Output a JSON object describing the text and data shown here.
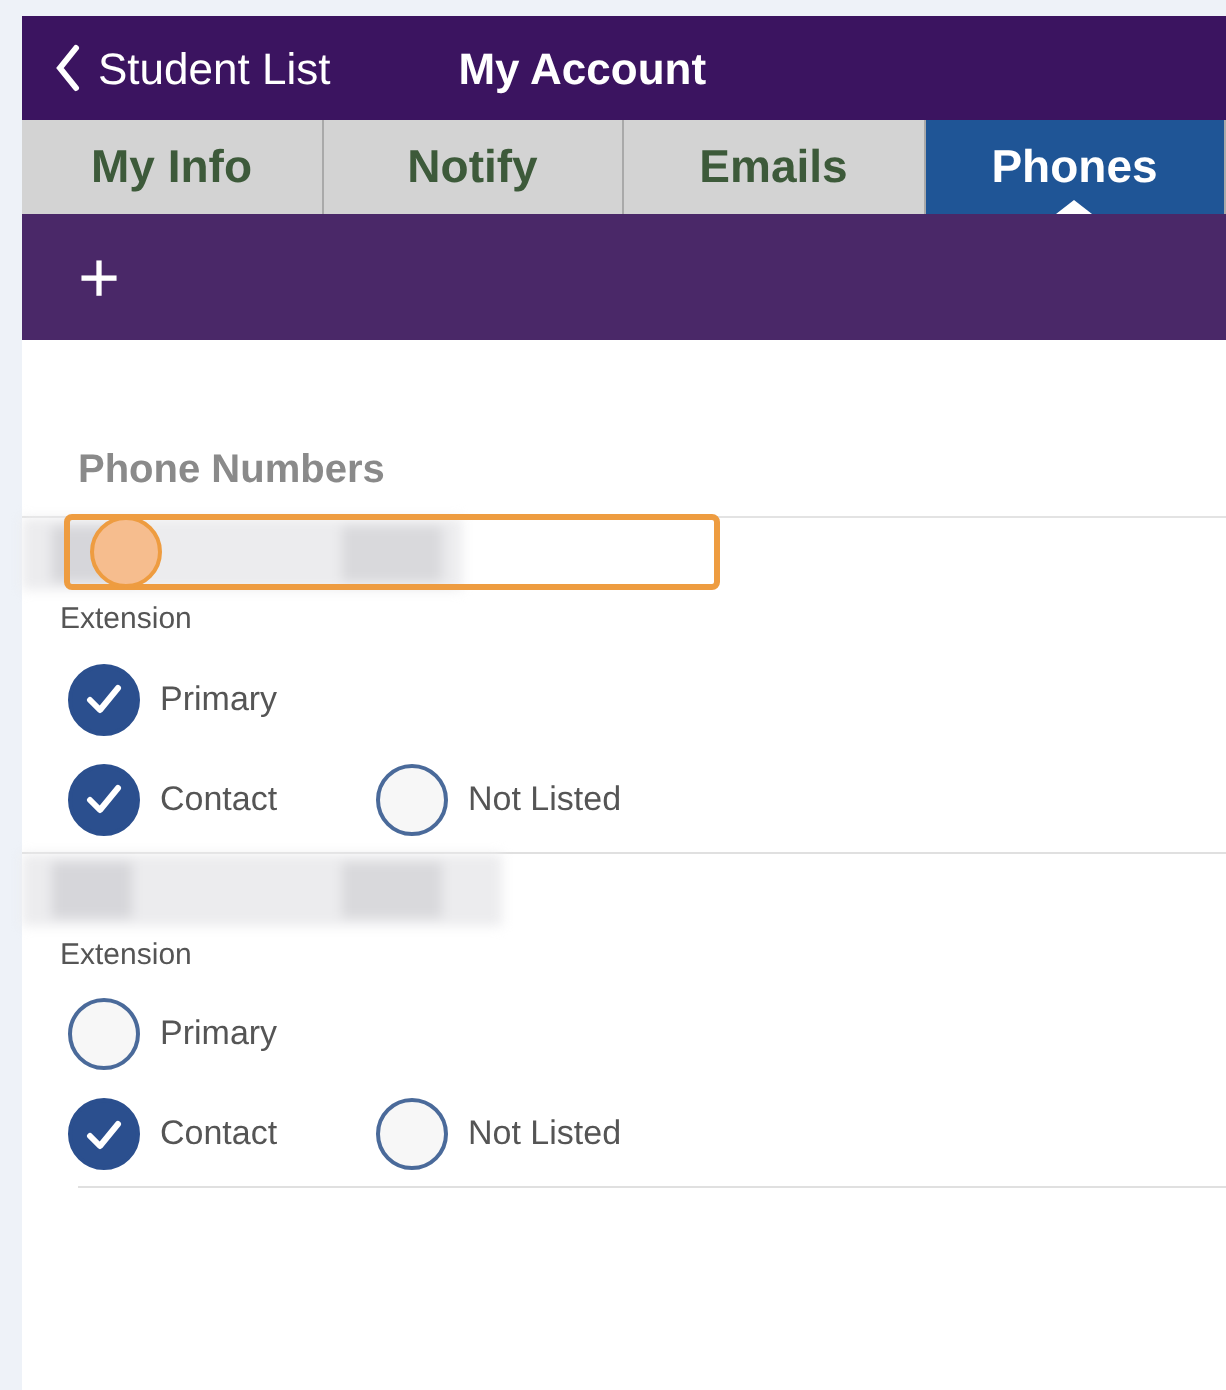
{
  "nav": {
    "back": "Student List",
    "title": "My Account"
  },
  "tabs": [
    {
      "label": "My Info",
      "selected": false
    },
    {
      "label": "Notify",
      "selected": false
    },
    {
      "label": "Emails",
      "selected": false
    },
    {
      "label": "Phones",
      "selected": true
    }
  ],
  "toolbar": {
    "add": "+"
  },
  "section_title": "Phone Numbers",
  "phones": [
    {
      "highlighted": true,
      "extension_label": "Extension",
      "option_rows": [
        [
          {
            "label": "Primary",
            "checked": true
          }
        ],
        [
          {
            "label": "Contact",
            "checked": true
          },
          {
            "label": "Not Listed",
            "checked": false
          }
        ]
      ]
    },
    {
      "highlighted": false,
      "extension_label": "Extension",
      "option_rows": [
        [
          {
            "label": "Primary",
            "checked": false
          }
        ],
        [
          {
            "label": "Contact",
            "checked": true
          },
          {
            "label": "Not Listed",
            "checked": false
          }
        ]
      ]
    }
  ]
}
